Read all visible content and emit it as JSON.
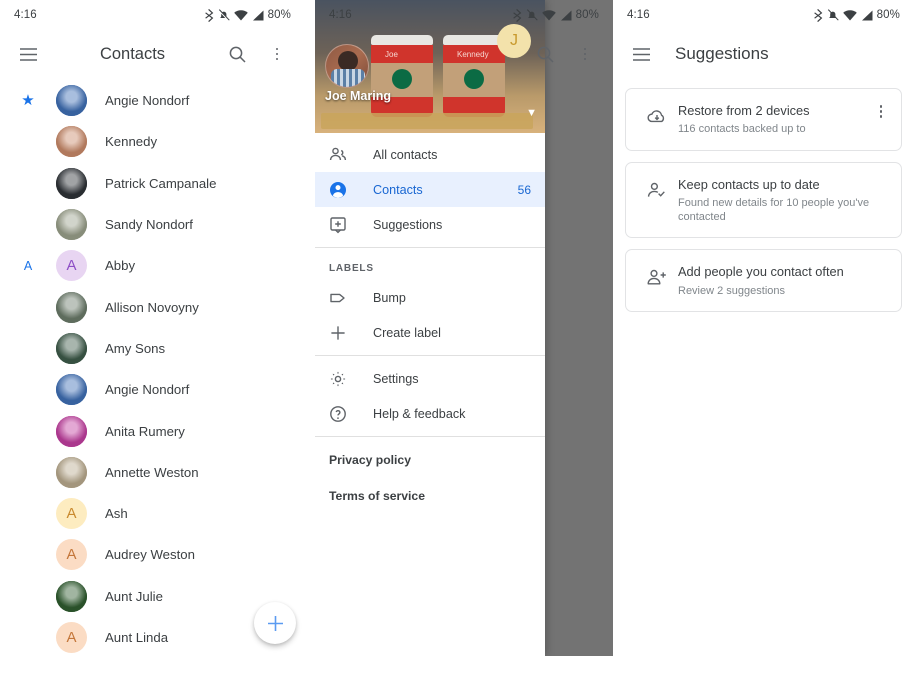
{
  "status_bar": {
    "time": "4:16",
    "battery": "80%",
    "icons": [
      "bluetooth-icon",
      "notifications-muted-icon",
      "wifi-icon",
      "cellular-signal-icon"
    ]
  },
  "colors": {
    "accent": "#1a73e8",
    "selected_bg": "#e8f0fe",
    "selected_text": "#1967d2",
    "text_primary": "#3c4043",
    "text_secondary": "#80868b",
    "scrim": "rgba(0,0,0,0.55)"
  },
  "panel_contacts": {
    "appbar": {
      "menu_icon": "hamburger-menu-icon",
      "title": "Contacts",
      "search_icon": "search-icon",
      "overflow_icon": "more-vert-icon"
    },
    "fab_label": "+",
    "sections": [
      {
        "header": "",
        "header_icon": "star-icon",
        "contacts": [
          {
            "name": "Angie Nondorf",
            "avatar_type": "photo",
            "avatar_color": "#3f6fb5",
            "initial": "A",
            "starred": true
          },
          {
            "name": "Kennedy",
            "avatar_type": "photo",
            "avatar_color": "#c98a6a",
            "initial": "K",
            "starred": false
          },
          {
            "name": "Patrick Campanale",
            "avatar_type": "photo",
            "avatar_color": "#2f3338",
            "initial": "P",
            "starred": false
          },
          {
            "name": "Sandy Nondorf",
            "avatar_type": "photo",
            "avatar_color": "#9aa08b",
            "initial": "S",
            "starred": false
          }
        ]
      },
      {
        "header": "A",
        "header_icon": "",
        "contacts": [
          {
            "name": "Abby",
            "avatar_type": "letter",
            "avatar_color": "#e8d5f2",
            "initial_color": "#8e4ec6",
            "initial": "A",
            "starred": false
          },
          {
            "name": "Allison Novoyny",
            "avatar_type": "photo",
            "avatar_color": "#6b7b6a",
            "initial": "A",
            "starred": false
          },
          {
            "name": "Amy Sons",
            "avatar_type": "photo",
            "avatar_color": "#3e5b4a",
            "initial": "A",
            "starred": false
          },
          {
            "name": "Angie Nondorf",
            "avatar_type": "photo",
            "avatar_color": "#3f6fb5",
            "initial": "A",
            "starred": false
          },
          {
            "name": "Anita Rumery",
            "avatar_type": "photo",
            "avatar_color": "#c23fa0",
            "initial": "A",
            "starred": false
          },
          {
            "name": "Annette Weston",
            "avatar_type": "photo",
            "avatar_color": "#b9aa8e",
            "initial": "A",
            "starred": false
          },
          {
            "name": "Ash",
            "avatar_type": "letter",
            "avatar_color": "#fdecc0",
            "initial_color": "#c98a2e",
            "initial": "A",
            "starred": false
          },
          {
            "name": "Audrey Weston",
            "avatar_type": "letter",
            "avatar_color": "#fbdcc4",
            "initial_color": "#c4763a",
            "initial": "A",
            "starred": false
          },
          {
            "name": "Aunt Julie",
            "avatar_type": "photo",
            "avatar_color": "#2f5c2f",
            "initial": "A",
            "starred": false
          },
          {
            "name": "Aunt Linda",
            "avatar_type": "letter",
            "avatar_color": "#fbdcc4",
            "initial_color": "#c4763a",
            "initial": "A",
            "starred": false
          }
        ]
      }
    ]
  },
  "panel_drawer": {
    "behind_appbar": {
      "search_icon": "search-icon",
      "overflow_icon": "more-vert-icon"
    },
    "header": {
      "account_name": "Joe Maring",
      "avatar_icon": "profile-photo-avatar",
      "cover_photo": "starbucks-cups-photo",
      "cup_labels": [
        "Joe",
        "Kennedy"
      ],
      "second_account_initial": "J",
      "expand_icon": "chevron-down-icon"
    },
    "items": [
      {
        "label": "All contacts",
        "icon": "people-icon",
        "count": "",
        "selected": false
      },
      {
        "label": "Contacts",
        "icon": "person-circle-icon",
        "count": "56",
        "selected": true
      },
      {
        "label": "Suggestions",
        "icon": "suggestions-box-icon",
        "count": "",
        "selected": false
      }
    ],
    "labels_section": "LABELS",
    "label_items": [
      {
        "label": "Bump",
        "icon": "label-tag-icon"
      },
      {
        "label": "Create label",
        "icon": "plus-icon"
      }
    ],
    "footer_items": [
      {
        "label": "Settings",
        "icon": "gear-icon"
      },
      {
        "label": "Help & feedback",
        "icon": "help-circle-icon"
      }
    ],
    "legal_links": [
      "Privacy policy",
      "Terms of service"
    ],
    "fab_label": "+"
  },
  "panel_suggestions": {
    "appbar": {
      "menu_icon": "hamburger-menu-icon",
      "title": "Suggestions"
    },
    "cards": [
      {
        "title": "Restore from 2 devices",
        "subtitle": "116 contacts backed up to",
        "icon": "cloud-download-icon",
        "has_overflow": true
      },
      {
        "title": "Keep contacts up to date",
        "subtitle": "Found new details for 10 people you've contacted",
        "icon": "person-check-icon",
        "has_overflow": false
      },
      {
        "title": "Add people you contact often",
        "subtitle": "Review 2 suggestions",
        "icon": "person-add-icon",
        "has_overflow": false
      }
    ]
  }
}
